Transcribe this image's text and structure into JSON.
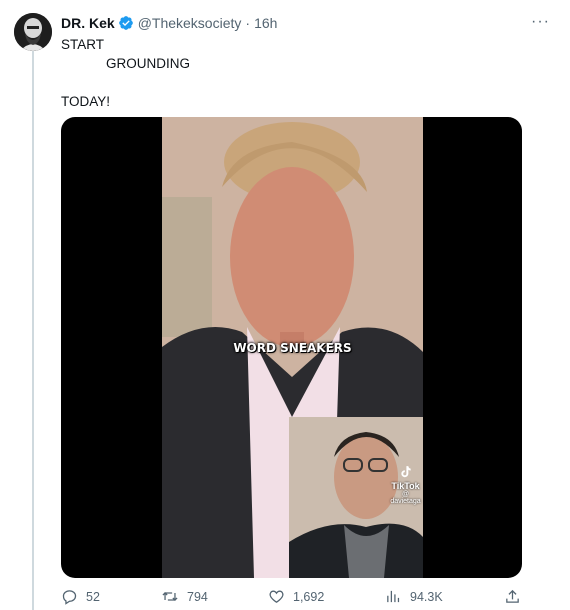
{
  "tweet": {
    "author_name": "DR. Kek",
    "handle": "@Thekeksociety",
    "separator": "·",
    "time": "16h",
    "more_label": "···",
    "text": "START\n            GROUNDING\n\nTODAY!"
  },
  "media": {
    "caption": "WORD SNEAKERS",
    "watermark_brand": "TikTok",
    "watermark_user": "@ davietaga"
  },
  "actions": {
    "replies": "52",
    "retweets": "794",
    "likes": "1,692",
    "views": "94.3K"
  },
  "colors": {
    "verified_blue": "#1d9bf0",
    "muted_text": "#536471",
    "thread_line": "#cfd9de"
  },
  "icons": [
    "verified-icon",
    "more-icon",
    "reply-icon",
    "retweet-icon",
    "like-icon",
    "views-icon",
    "share-icon"
  ]
}
